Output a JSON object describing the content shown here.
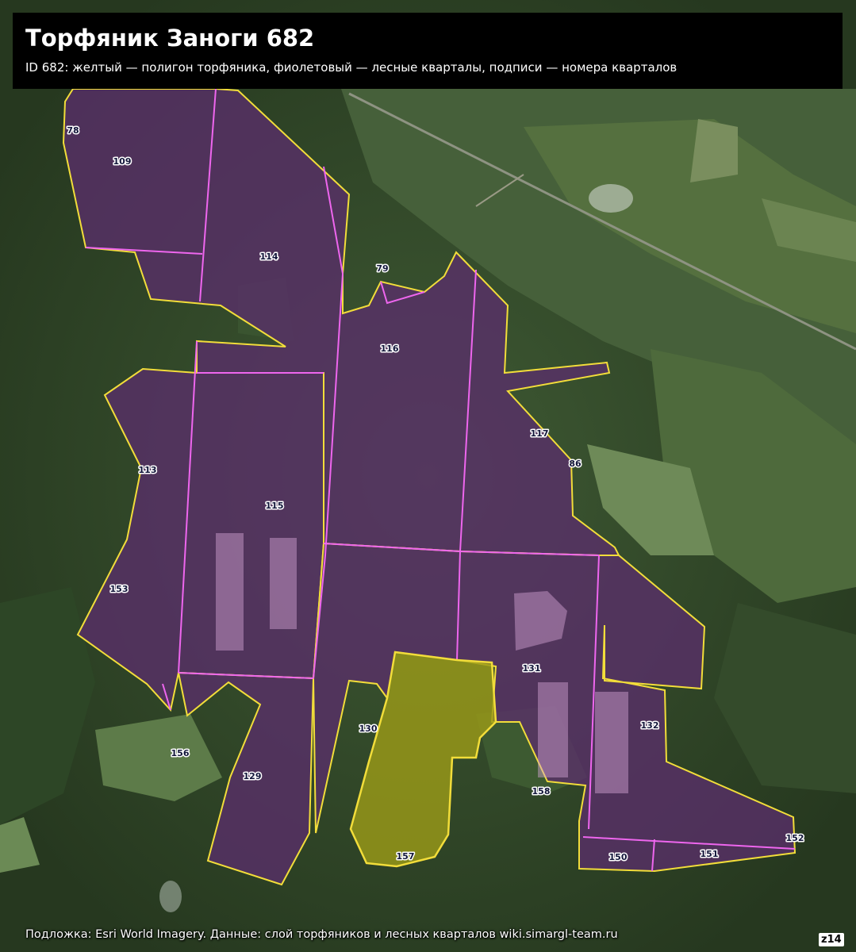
{
  "header": {
    "title": "Торфяник Заноги 682",
    "subtitle": "ID 682: желтый — полигон торфяника, фиолетовый — лесные кварталы, подписи — номера кварталов"
  },
  "attribution": "Подложка: Esri World Imagery. Данные: слой торфяников и лесных кварталов wiki.simargl-team.ru",
  "zoom_label": "z14",
  "colors": {
    "peat_outline": "#f2dd3a",
    "peat_fill": "#9a9a18",
    "quarter_line": "#ee66ee",
    "quarter_fill": "#5a2e6a"
  },
  "quarters": [
    "78",
    "109",
    "114",
    "79",
    "116",
    "113",
    "115",
    "117",
    "86",
    "153",
    "131",
    "130",
    "132",
    "156",
    "129",
    "158",
    "157",
    "150",
    "151",
    "152"
  ]
}
